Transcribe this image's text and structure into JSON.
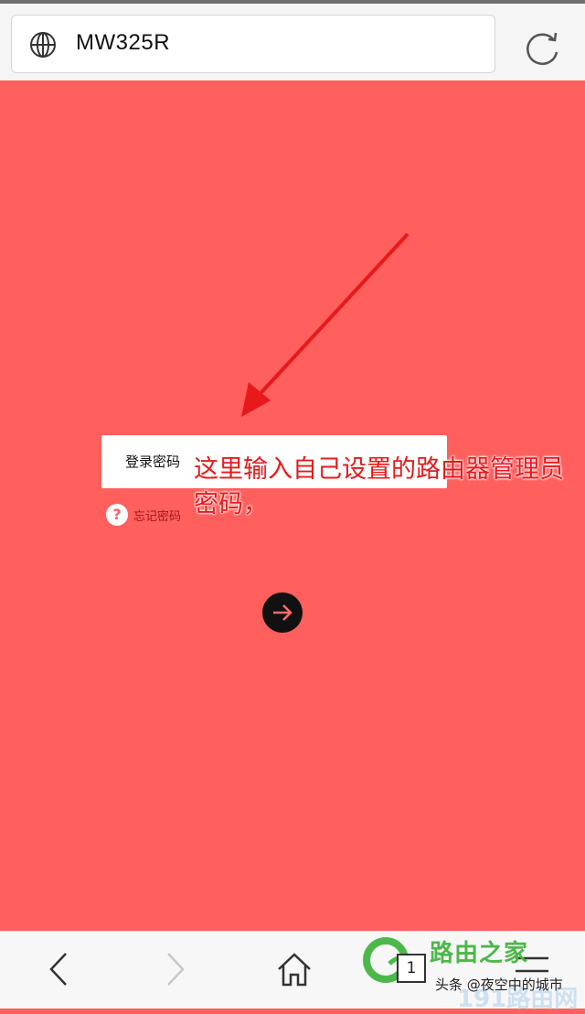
{
  "browser": {
    "address": "MW325R"
  },
  "login": {
    "password_label": "登录密码",
    "forgot_label": "忘记密码",
    "forgot_icon": "?"
  },
  "annotation": {
    "text": "这里输入自己设置的路由器管理员密码，",
    "color": "#e8191b"
  },
  "nav": {
    "tab_count": "1"
  },
  "watermark": {
    "brand": "路由之家",
    "source": "头条 @夜空中的城市",
    "site": "191路由网"
  },
  "colors": {
    "background": "#ff5f5d",
    "button": "#111111"
  }
}
